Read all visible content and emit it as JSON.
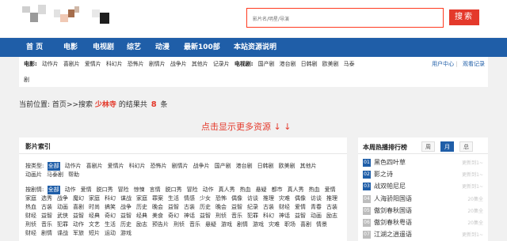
{
  "search": {
    "placeholder": "影片名/明星/导演",
    "button_label": "搜索"
  },
  "nav": {
    "items": [
      "首 页",
      "电影",
      "电视剧",
      "综艺",
      "动漫",
      "最新100部",
      "本站资源说明"
    ]
  },
  "subnav": {
    "movie_label": "电影:",
    "movie_items": [
      "动作片",
      "喜剧片",
      "爱情片",
      "科幻片",
      "恐怖片",
      "剧情片",
      "战争片",
      "其他片",
      "记录片"
    ],
    "tv_label": "电视剧:",
    "tv_items": [
      "国产剧",
      "港台剧",
      "日韩剧",
      "欧美剧",
      "马泰"
    ],
    "tv_overflow": "剧",
    "user_center": "用户中心",
    "divider": "|",
    "history": "观看记录"
  },
  "breadcrumb": {
    "prefix": "当前位置:",
    "home": "首页",
    "arrow": ">>",
    "search_text": "搜索",
    "keyword": "少林寺",
    "mid_text": "的结果共",
    "count": "8",
    "suffix": "条"
  },
  "more_resources": "点击显示更多资源 ↓ ↓",
  "index_panel": {
    "title": "影片索引",
    "type_label": "按类型:",
    "type_tags": [
      "全部",
      "动作片",
      "喜剧片",
      "爱情片",
      "科幻片",
      "恐怖片",
      "剧情片",
      "战争片",
      "国产剧",
      "港台剧",
      "日韩剧",
      "欧美剧",
      "其他片",
      "动画片",
      "马泰剧",
      "帮助"
    ],
    "plot_label": "按剧情:",
    "plot_tags": [
      "全部",
      "动作",
      "爱情",
      "脱口秀",
      "冒险",
      "惊悚",
      "言情",
      "脱口秀",
      "冒险",
      "动作",
      "真人秀",
      "热血",
      "悬疑",
      "都市",
      "真人秀",
      "热血",
      "爱情",
      "家庭",
      "选秀",
      "战争",
      "魔幻",
      "家庭",
      "科幻",
      "谋战",
      "家庭",
      "罪案",
      "生活",
      "情感",
      "少女",
      "恐怖",
      "偶像",
      "访谈",
      "推理",
      "灾难",
      "偶像",
      "访谈",
      "推理",
      "热血",
      "古装",
      "动画",
      "喜剧",
      "时尚",
      "搞笑",
      "战争",
      "历史",
      "晚会",
      "益智",
      "古装",
      "历史",
      "晚会",
      "益智",
      "纪录",
      "古装",
      "财经",
      "爱情",
      "青春",
      "古装",
      "财经",
      "益智",
      "武侠",
      "益智",
      "经典",
      "奇幻",
      "益智",
      "经典",
      "美食",
      "奇幻",
      "神话",
      "益智",
      "刑侦",
      "音乐",
      "犯罪",
      "科幻",
      "神话",
      "益智",
      "动画",
      "励志",
      "刑侦",
      "音乐",
      "犯罪",
      "动作",
      "文艺",
      "生活",
      "历史",
      "励志",
      "预告片",
      "刑侦",
      "音乐",
      "悬疑",
      "游戏",
      "剧情",
      "游戏",
      "灾难",
      "职场",
      "喜剧",
      "情景",
      "财经",
      "剧情",
      "谍战",
      "军旅",
      "短片",
      "运动",
      "游戏"
    ]
  },
  "rank_panel": {
    "title": "本周热播排行榜",
    "tabs": [
      "周",
      "月",
      "总"
    ],
    "active_tab": 1,
    "items": [
      {
        "num": "01",
        "name": "黑色四叶草",
        "status": "更新到1~"
      },
      {
        "num": "02",
        "name": "影之诗",
        "status": "更新到1~"
      },
      {
        "num": "03",
        "name": "战双帕尼尼",
        "status": "更新到1~"
      },
      {
        "num": "04",
        "name": "人海骄阳国语",
        "status": "20集全"
      },
      {
        "num": "05",
        "name": "傲剑春秋国语",
        "status": "20集全"
      },
      {
        "num": "06",
        "name": "傲剑春秋粤语",
        "status": "20集全"
      },
      {
        "num": "07",
        "name": "江湖之逍遥语",
        "status": "更新到1~"
      }
    ]
  },
  "colors": {
    "accent_blue": "#1f5ea8",
    "accent_red": "#e4392b",
    "search_border": "#ff3a1f"
  }
}
